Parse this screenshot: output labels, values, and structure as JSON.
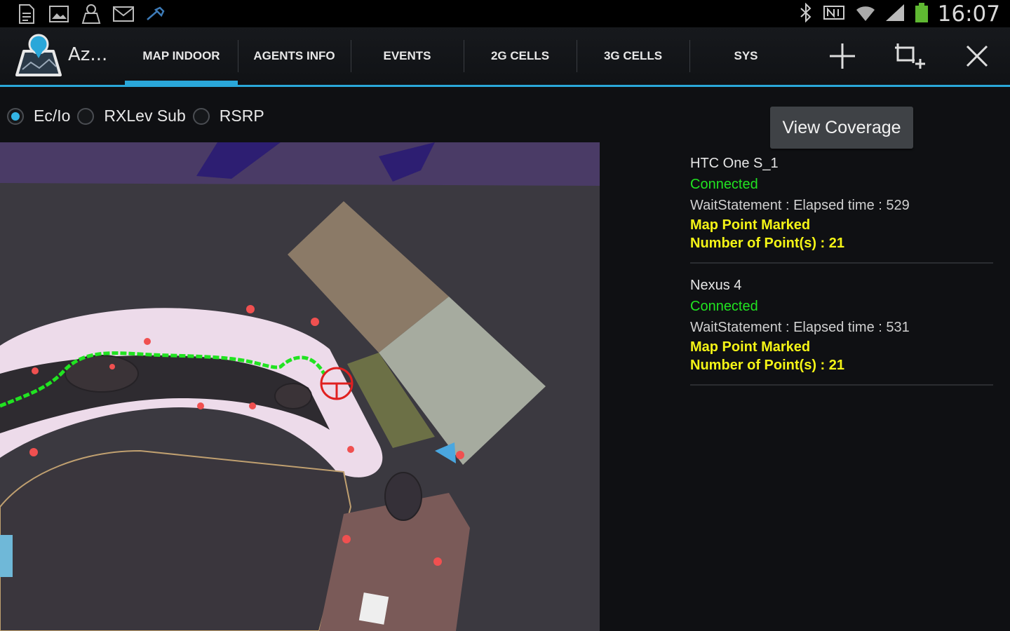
{
  "status_bar": {
    "left_icons": [
      "file-icon",
      "image-icon",
      "app-notify-icon",
      "mail-icon",
      "wrench-icon"
    ],
    "right_icons": [
      "bluetooth-icon",
      "nfc-icon",
      "wifi-icon",
      "signal-icon",
      "battery-icon"
    ],
    "time": "16:07"
  },
  "action_bar": {
    "app_icon": "app-logo-icon",
    "title": "Az...",
    "tabs": [
      {
        "label": "MAP INDOOR",
        "active": true
      },
      {
        "label": "AGENTS INFO",
        "active": false
      },
      {
        "label": "EVENTS",
        "active": false
      },
      {
        "label": "2G CELLS",
        "active": false
      },
      {
        "label": "3G CELLS",
        "active": false
      },
      {
        "label": "SYS",
        "active": false
      }
    ],
    "actions": [
      "add-icon",
      "crop-add-icon",
      "close-icon"
    ]
  },
  "measure": {
    "options": [
      {
        "label": "Ec/Io",
        "checked": true
      },
      {
        "label": "RXLev Sub",
        "checked": false
      },
      {
        "label": "RSRP",
        "checked": false
      }
    ]
  },
  "view_coverage_label": "View Coverage",
  "agents": [
    {
      "name": "HTC One S_1",
      "status": "Connected",
      "wait": "WaitStatement : Elapsed time : 529",
      "mark": "Map Point Marked",
      "points": "Number of Point(s) : 21"
    },
    {
      "name": "Nexus 4",
      "status": "Connected",
      "wait": "WaitStatement : Elapsed time : 531",
      "mark": "Map Point Marked",
      "points": "Number of Point(s) : 21"
    }
  ],
  "colors": {
    "accent": "#2aa7d9",
    "connected": "#21e321",
    "marked": "#f4f416",
    "route": "#21e321"
  }
}
